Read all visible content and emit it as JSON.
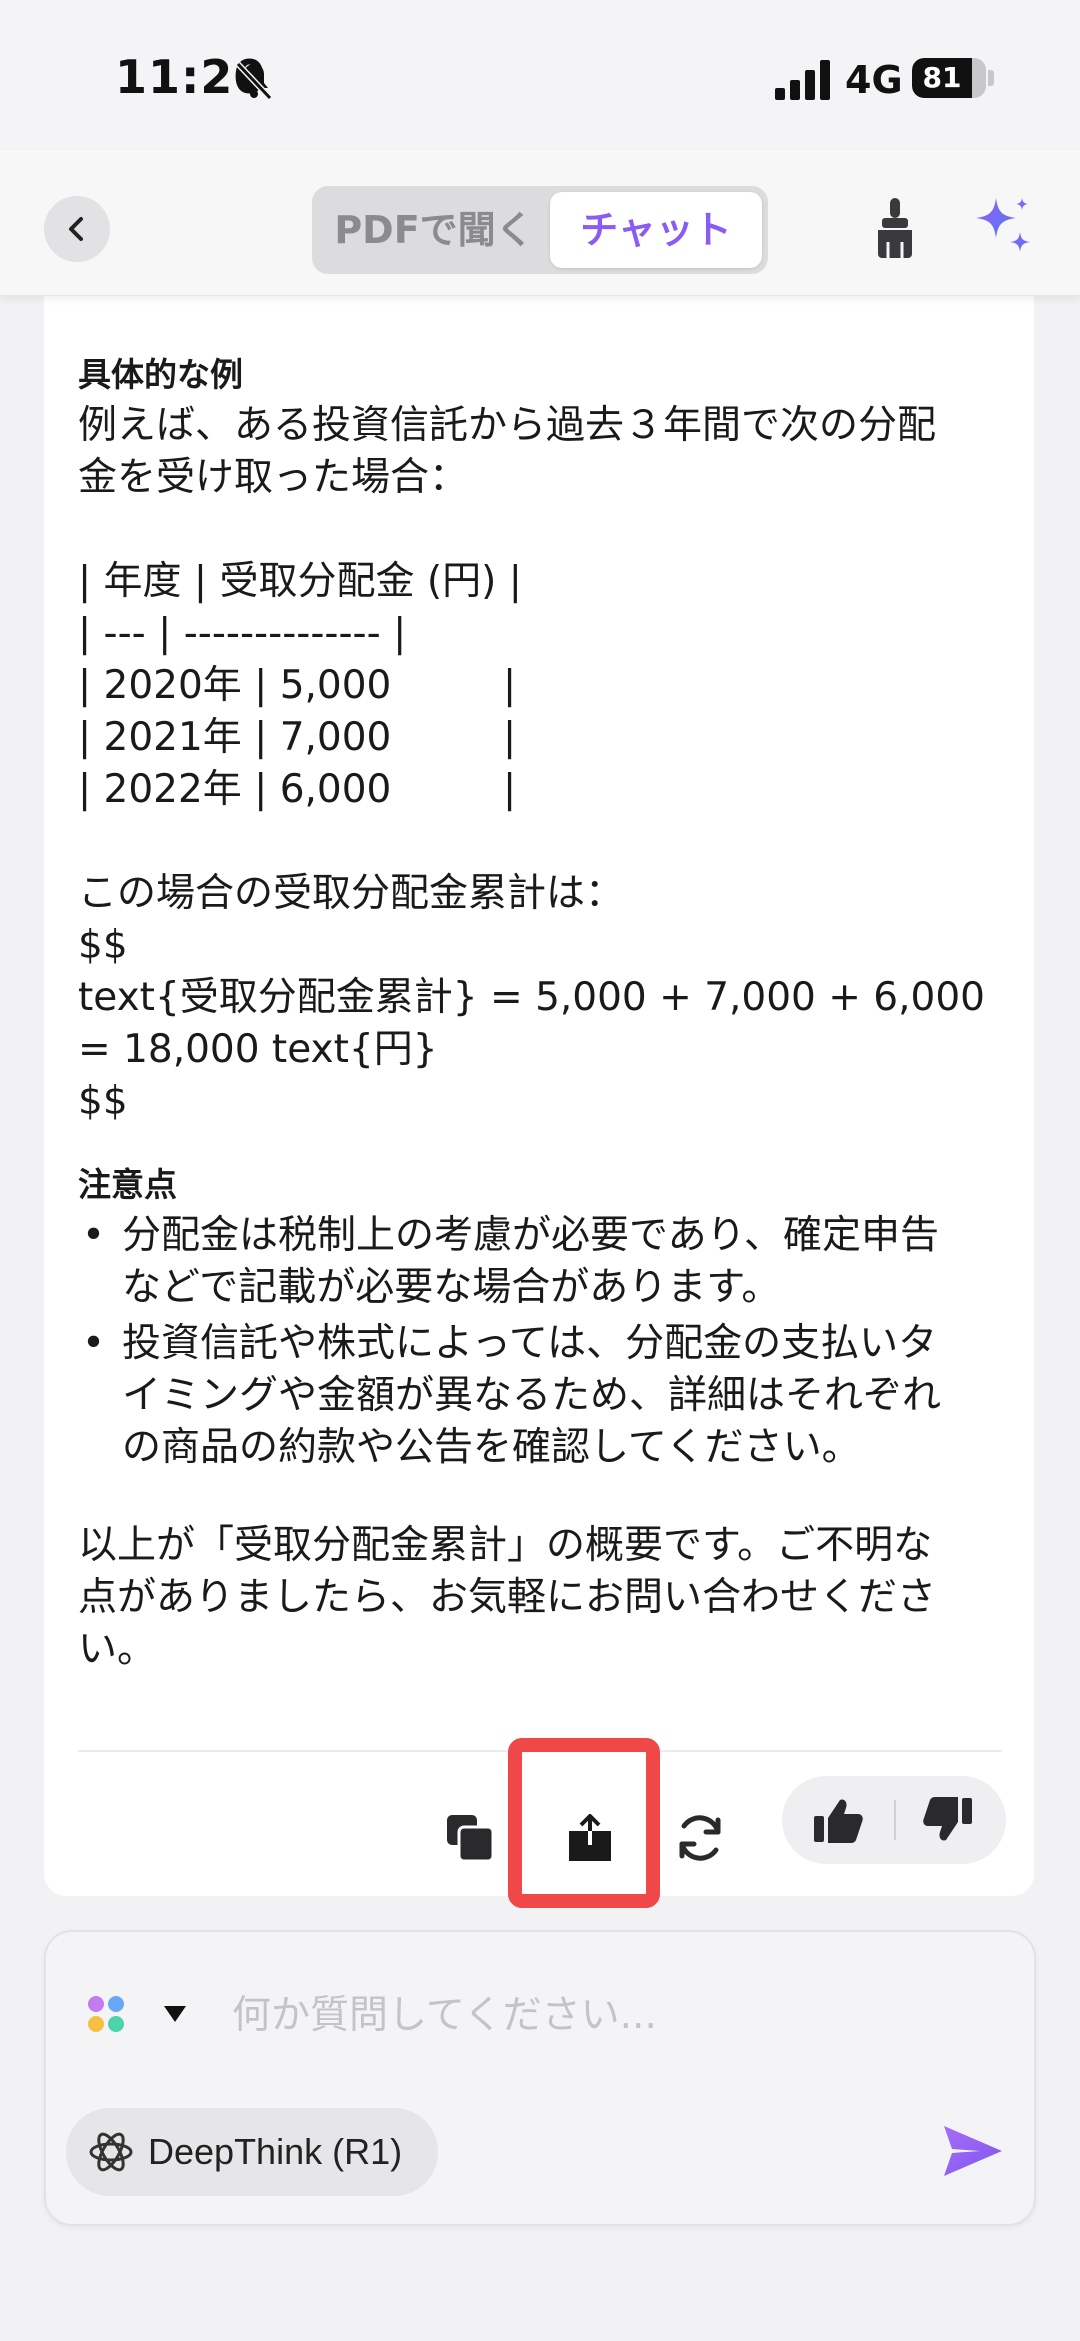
{
  "status_bar": {
    "time": "11:20",
    "network": "4G",
    "battery": "81",
    "battery_level": 0.81
  },
  "header": {
    "back_icon": "chevron-left-icon",
    "tabs": [
      {
        "label": "PDFで聞く",
        "active": false
      },
      {
        "label": "チャット",
        "active": true
      }
    ],
    "accent_color": "#8a5cf5",
    "clear_icon": "brush-icon",
    "ai_icon": "sparkle-icon"
  },
  "message": {
    "heading_example": "具体的な例",
    "intro": [
      "例えば、ある投資信託から過去３年間で次の分配",
      "金を受け取った場合："
    ],
    "table_lines": [
      "| 年度 | 受取分配金 (円) |",
      "| --- | -------------- |",
      "| 2020年 | 5,000         |",
      "| 2021年 | 7,000         |",
      "| 2022年 | 6,000         |"
    ],
    "calc_intro": "この場合の受取分配金累計は：",
    "formula_lines": [
      "$$",
      "text{受取分配金累計} = 5,000 + 7,000 + 6,000",
      "= 18,000 text{円}",
      "$$"
    ],
    "heading_notes": "注意点",
    "bullets": [
      [
        "分配金は税制上の考慮が必要であり、確定申告",
        "などで記載が必要な場合があります。"
      ],
      [
        "投資信託や株式によっては、分配金の支払いタ",
        "イミングや金額が異なるため、詳細はそれぞれ",
        "の商品の約款や公告を確認してください。"
      ]
    ],
    "closing": [
      "以上が「受取分配金累計」の概要です。ご不明な",
      "点がありましたら、お気軽にお問い合わせくださ",
      "い。"
    ]
  },
  "actions": {
    "copy_icon": "copy-icon",
    "share_icon": "share-icon",
    "regenerate_icon": "refresh-icon",
    "like_icon": "thumbs-up-icon",
    "dislike_icon": "thumbs-down-icon",
    "highlight_color": "#f04848"
  },
  "composer": {
    "placeholder": "何か質問してください...",
    "model_icon": "model-dots-icon",
    "deepthink_label": "DeepThink (R1)",
    "send_icon": "send-icon"
  }
}
